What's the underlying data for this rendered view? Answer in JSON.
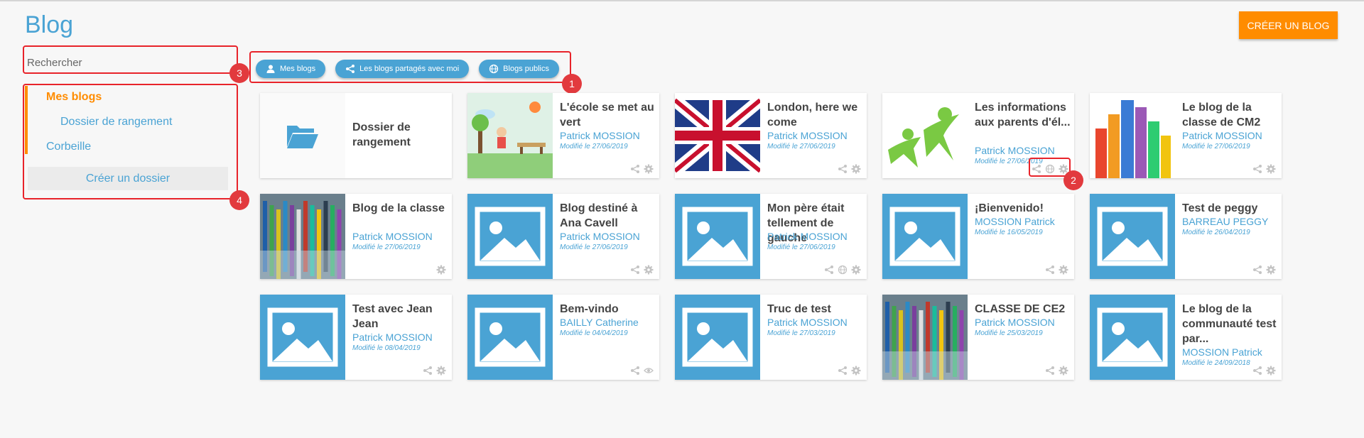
{
  "header": {
    "title": "Blog",
    "create_label": "CRÉER UN BLOG"
  },
  "search": {
    "placeholder": "Rechercher"
  },
  "filters": [
    {
      "label": "Mes blogs",
      "icon": "user-icon"
    },
    {
      "label": "Les blogs partagés avec moi",
      "icon": "share-icon"
    },
    {
      "label": "Blogs publics",
      "icon": "globe-icon"
    }
  ],
  "sidebar": {
    "items": [
      {
        "label": "Mes blogs"
      },
      {
        "label": "Dossier de rangement"
      },
      {
        "label": "Corbeille"
      }
    ],
    "create_folder": "Créer un dossier"
  },
  "callouts": [
    "1",
    "2",
    "3",
    "4"
  ],
  "folder_card": {
    "title": "Dossier de rangement"
  },
  "blogs": [
    {
      "title": "L'école se met au vert",
      "author": "Patrick MOSSION",
      "date": "Modifié le 27/06/2019",
      "thumb": "cartoon"
    },
    {
      "title": "London, here we come",
      "author": "Patrick MOSSION",
      "date": "Modifié le 27/06/2019",
      "thumb": "flag"
    },
    {
      "title": "Les informations aux parents d'él...",
      "author": "Patrick MOSSION",
      "date": "Modifié le 27/06/2019",
      "thumb": "people"
    },
    {
      "title": "Le blog de la classe de CM2",
      "author": "Patrick MOSSION",
      "date": "Modifié le 27/06/2019",
      "thumb": "hands"
    },
    {
      "title": "Blog de la classe",
      "author": "Patrick MOSSION",
      "date": "Modifié le 27/06/2019",
      "thumb": "pencils"
    },
    {
      "title": "Blog destiné à Ana Cavell",
      "author": "Patrick MOSSION",
      "date": "Modifié le 27/06/2019",
      "thumb": "placeholder"
    },
    {
      "title": "Mon père était tellement de gauche",
      "author": "Patrick MOSSION",
      "date": "Modifié le 27/06/2019",
      "thumb": "placeholder"
    },
    {
      "title": "¡Bienvenido!",
      "author": "MOSSION Patrick",
      "date": "Modifié le 16/05/2019",
      "thumb": "placeholder"
    },
    {
      "title": "Test de peggy",
      "author": "BARREAU PEGGY",
      "date": "Modifié le 26/04/2019",
      "thumb": "placeholder"
    },
    {
      "title": "Test avec Jean Jean",
      "author": "Patrick MOSSION",
      "date": "Modifié le 08/04/2019",
      "thumb": "placeholder"
    },
    {
      "title": "Bem-vindo",
      "author": "BAILLY Catherine",
      "date": "Modifié le 04/04/2019",
      "thumb": "placeholder"
    },
    {
      "title": "Truc de test",
      "author": "Patrick MOSSION",
      "date": "Modifié le 27/03/2019",
      "thumb": "placeholder"
    },
    {
      "title": "CLASSE DE CE2",
      "author": "Patrick MOSSION",
      "date": "Modifié le 25/03/2019",
      "thumb": "pencils"
    },
    {
      "title": "Le blog de la communauté test par...",
      "author": "MOSSION Patrick",
      "date": "Modifié le 24/09/2018",
      "thumb": "placeholder"
    }
  ],
  "colors": {
    "accent": "#ff8c00",
    "primary": "#4aa3d4",
    "callout": "#e23a3e"
  }
}
